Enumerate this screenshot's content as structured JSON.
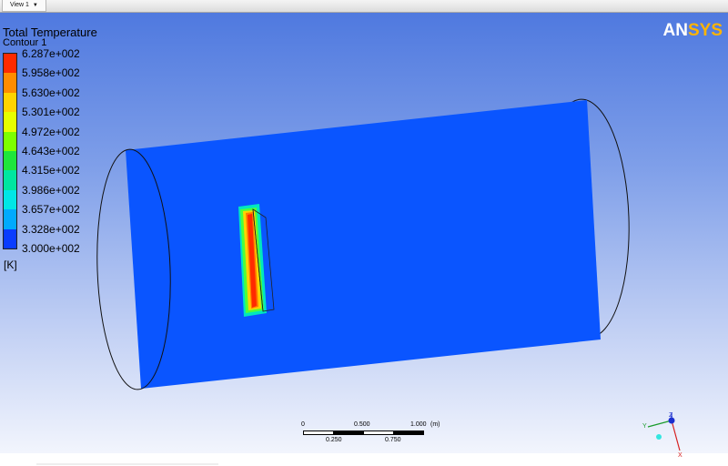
{
  "tabs": [
    {
      "label": "View 1",
      "icon": "chevron-down-icon"
    }
  ],
  "logo": {
    "main": "AN",
    "accent": "SYS",
    "accent_color": "#ffb400"
  },
  "legend": {
    "title": "Total Temperature",
    "subtitle": "Contour 1",
    "unit": "[K]",
    "values": [
      "6.287e+002",
      "5.958e+002",
      "5.630e+002",
      "5.301e+002",
      "4.972e+002",
      "4.643e+002",
      "4.315e+002",
      "3.986e+002",
      "3.657e+002",
      "3.328e+002",
      "3.000e+002"
    ],
    "colors": [
      "#ff2a00",
      "#ff8c00",
      "#ffd400",
      "#e6ff00",
      "#7dff00",
      "#1ee63c",
      "#00e6a0",
      "#00e6e6",
      "#00aaff",
      "#1e6eff",
      "#0a3cff"
    ]
  },
  "scalebar": {
    "top_labels": [
      "0",
      "0.500",
      "1.000",
      "(m)"
    ],
    "bottom_labels": [
      "0.250",
      "0.750"
    ]
  },
  "triad": {
    "axes": [
      "Y",
      "Z",
      "X"
    ],
    "colors": {
      "Y": "#1a9c2c",
      "Z": "#1b2fcf",
      "X": "#d62020"
    }
  },
  "viewport": {
    "background_top": "#4f79df",
    "background_bottom": "#f2f5fd",
    "body_color": "#0a55ff"
  }
}
